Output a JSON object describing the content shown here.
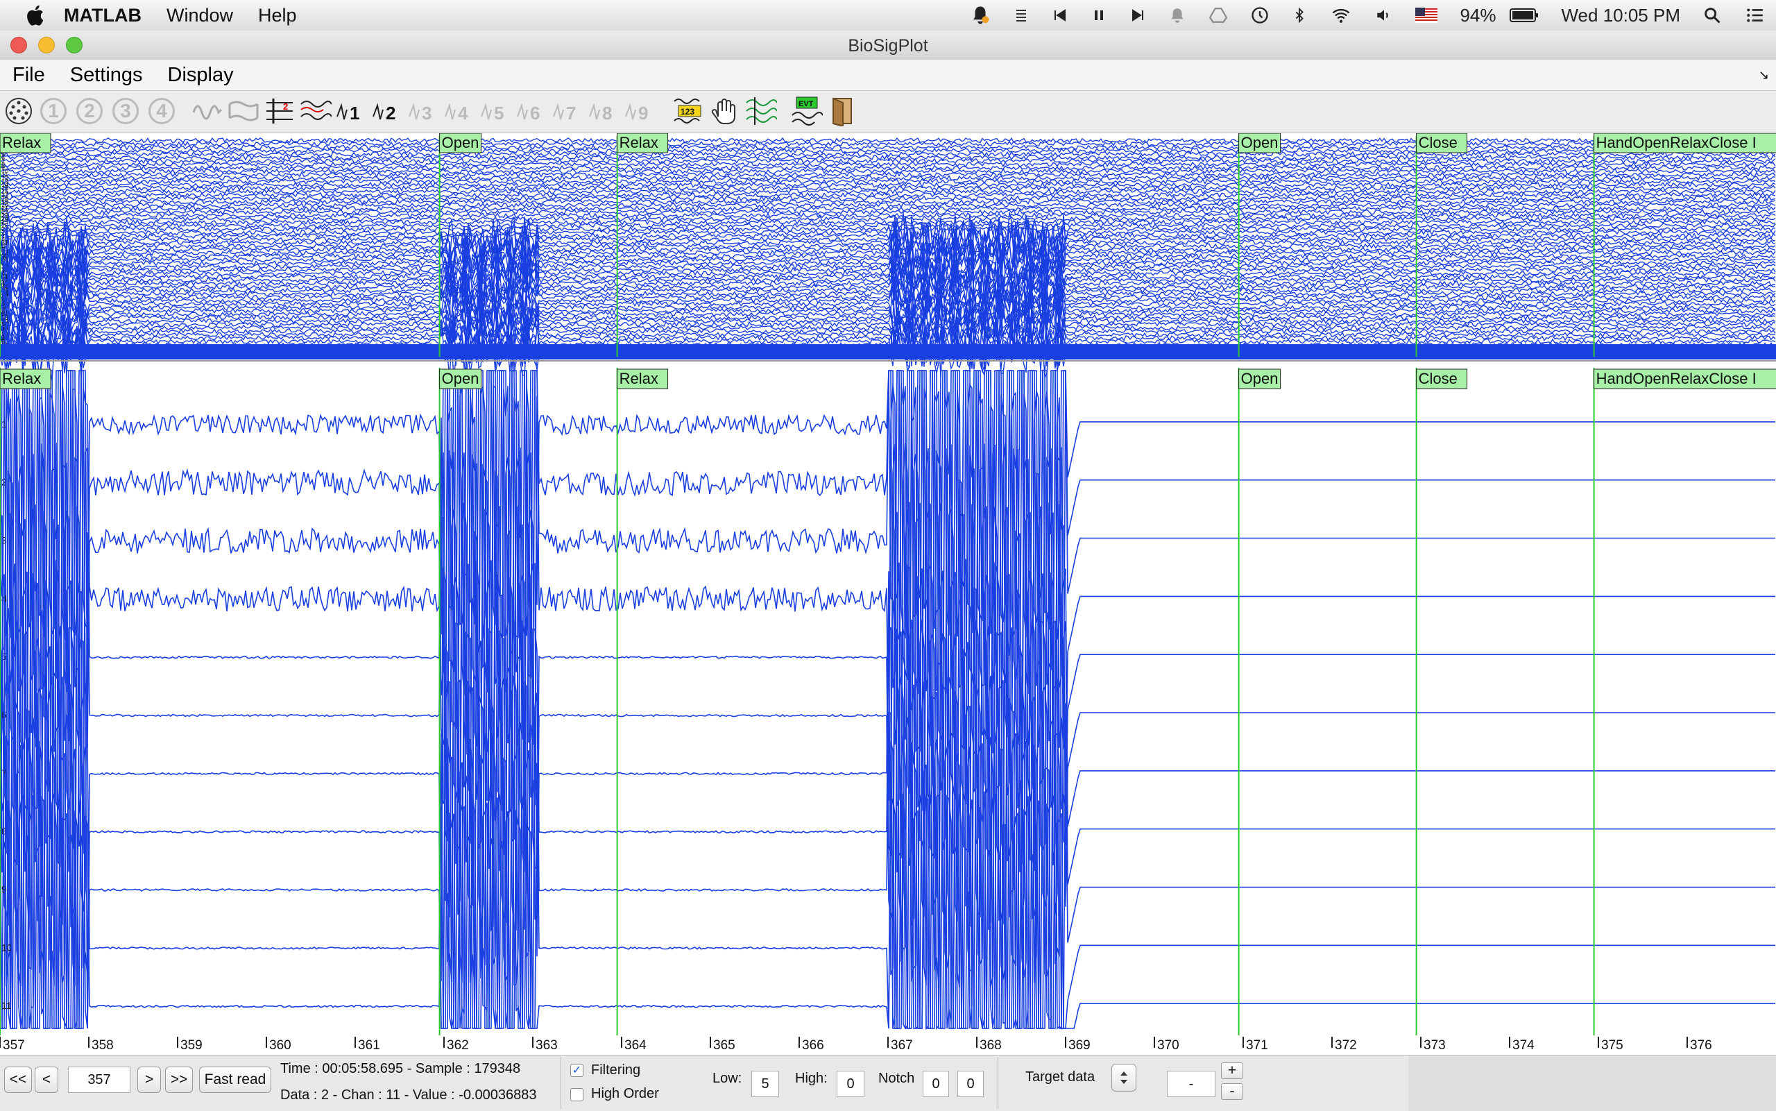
{
  "mac_menubar": {
    "app_name": "MATLAB",
    "menus": [
      "Window",
      "Help"
    ],
    "battery_percent": "94%",
    "clock": "Wed 10:05 PM"
  },
  "window": {
    "title": "BioSigPlot"
  },
  "app_menu": [
    "File",
    "Settings",
    "Display"
  ],
  "toolbar": {
    "view_buttons": [
      "1",
      "2",
      "3",
      "4"
    ],
    "numbered_buttons": [
      "3",
      "4",
      "5",
      "6",
      "7",
      "8",
      "9"
    ],
    "label_1": "1",
    "label_2": "2",
    "evt_label": "EVT",
    "digits_label": "123"
  },
  "signal_color": "#1a3fe0",
  "event_color": "#2ec92e",
  "event_label_bg": "#a8f0a8",
  "events": [
    {
      "label": "Relax",
      "time": 357.0
    },
    {
      "label": "Open",
      "time": 361.95
    },
    {
      "label": "Relax",
      "time": 363.95
    },
    {
      "label": "Open",
      "time": 370.95
    },
    {
      "label": "Close",
      "time": 372.95
    },
    {
      "label": "HandOpenRelaxClose I",
      "time": 374.95
    }
  ],
  "upper_panel": {
    "channel_labels": [
      "1",
      "2",
      "3",
      "4",
      "5",
      "6",
      "7",
      "8",
      "9",
      "10",
      "11",
      "12",
      "13",
      "14",
      "15",
      "16",
      "17",
      "18",
      "19",
      "20",
      "21",
      "22",
      "23",
      "24",
      "25",
      "26",
      "27",
      "28",
      "29",
      "30",
      "31",
      "32",
      "33",
      "34",
      "35",
      "36",
      "37",
      "38",
      "39",
      "40",
      "41",
      "42",
      "43",
      "44",
      "45",
      "46",
      "47",
      "48",
      "49",
      "50",
      "51",
      "52",
      "53",
      "54",
      "55",
      "56",
      "57",
      "58",
      "59",
      "60",
      "61",
      "62",
      "63",
      "64"
    ]
  },
  "lower_panel": {
    "channel_labels": [
      "1",
      "2",
      "3",
      "4",
      "5",
      "6",
      "7",
      "8",
      "9",
      "10",
      "11"
    ]
  },
  "time_axis": {
    "start": 357,
    "end": 377,
    "tick_labels": [
      "357",
      "358",
      "359",
      "360",
      "361",
      "362",
      "363",
      "364",
      "365",
      "366",
      "367",
      "368",
      "369",
      "370",
      "371",
      "372",
      "373",
      "374",
      "375",
      "376"
    ]
  },
  "bottom": {
    "first_label": "<<",
    "prev_label": "<",
    "time_value": "357",
    "next_label": ">",
    "last_label": ">>",
    "fast_read_label": "Fast read",
    "time_info": "Time : 00:05:58.695 - Sample : 179348",
    "data_info": "Data : 2 - Chan : 11 - Value : -0.00036883",
    "filtering_label": "Filtering",
    "filtering_checked": "✓",
    "high_order_label": "High Order",
    "low_label": "Low:",
    "low_value": "5",
    "high_label": "High:",
    "high_value": "0",
    "notch_label": "Notch",
    "notch_value_1": "0",
    "notch_value_2": "0",
    "target_label": "Target data",
    "target_value": "-",
    "plus_label": "+",
    "minus_label": "-"
  }
}
